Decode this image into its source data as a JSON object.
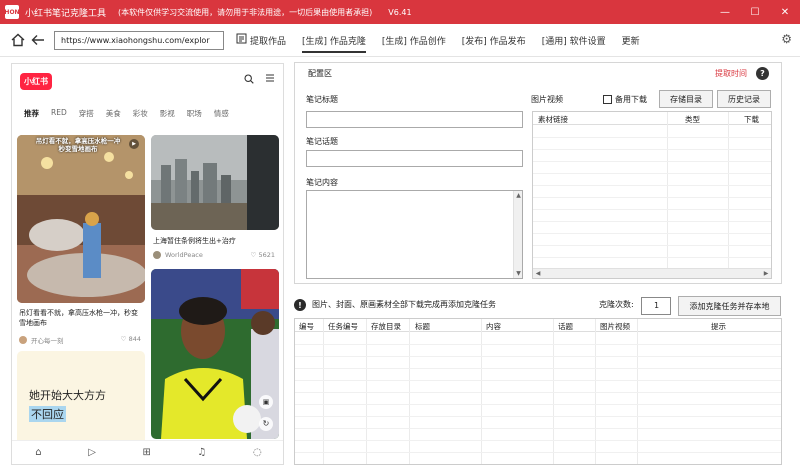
{
  "window": {
    "app_icon_text": "HON",
    "title": "小红书笔记克隆工具",
    "notice": "(本软件仅供学习交流使用，请勿用于非法用途，一切后果由使用者承担)",
    "version": "V6.41",
    "minimize": "—",
    "maximize": "☐",
    "close": "✕"
  },
  "toolbar": {
    "url": "https://www.xiaohongshu.com/explor",
    "tabs": [
      {
        "label": "提取作品"
      },
      {
        "label": "[生成] 作品克隆"
      },
      {
        "label": "[生成] 作品创作"
      },
      {
        "label": "[发布] 作品发布"
      },
      {
        "label": "[通用] 软件设置"
      },
      {
        "label": "更新"
      }
    ],
    "active_tab": 1,
    "accent_color": "#d9363e"
  },
  "phone": {
    "logo": "小红书",
    "categories": [
      "推荐",
      "RED",
      "穿搭",
      "美食",
      "彩妆",
      "影视",
      "职场",
      "情感"
    ],
    "cards": [
      {
        "overlay_text": "吊灯看不就，拿高压水枪一冲\n秒变雪地画布",
        "caption": "吊灯看看不就，拿高压水枪一冲，秒变雪地画布",
        "author": "开心每一刻",
        "likes": "844"
      },
      {
        "caption": "上海暂住条例将生出+治疗",
        "author": "WorldPeace",
        "likes": "5621"
      },
      {
        "text_line1": "她开始大大方方",
        "text_line2": "不回应"
      },
      {
        "caption": ""
      }
    ]
  },
  "config": {
    "title": "配置区",
    "extract_time": "提取时间",
    "note_title_label": "笔记标题",
    "note_topic_label": "笔记话题",
    "note_content_label": "笔记内容",
    "media_label": "图片视频",
    "backup_download": "备用下载",
    "storage_dir_button": "存储目录",
    "history_button": "历史记录",
    "media_columns": [
      "素材链接",
      "类型",
      "下载"
    ]
  },
  "task": {
    "info": "图片、封面、原画素材全部下载完成再添加克隆任务",
    "clone_count_label": "克隆次数:",
    "clone_count_value": "1",
    "add_button": "添加克隆任务并存本地",
    "columns": [
      "编号",
      "任务编号",
      "存放目录",
      "标题",
      "内容",
      "话题",
      "图片视频",
      "提示"
    ]
  }
}
